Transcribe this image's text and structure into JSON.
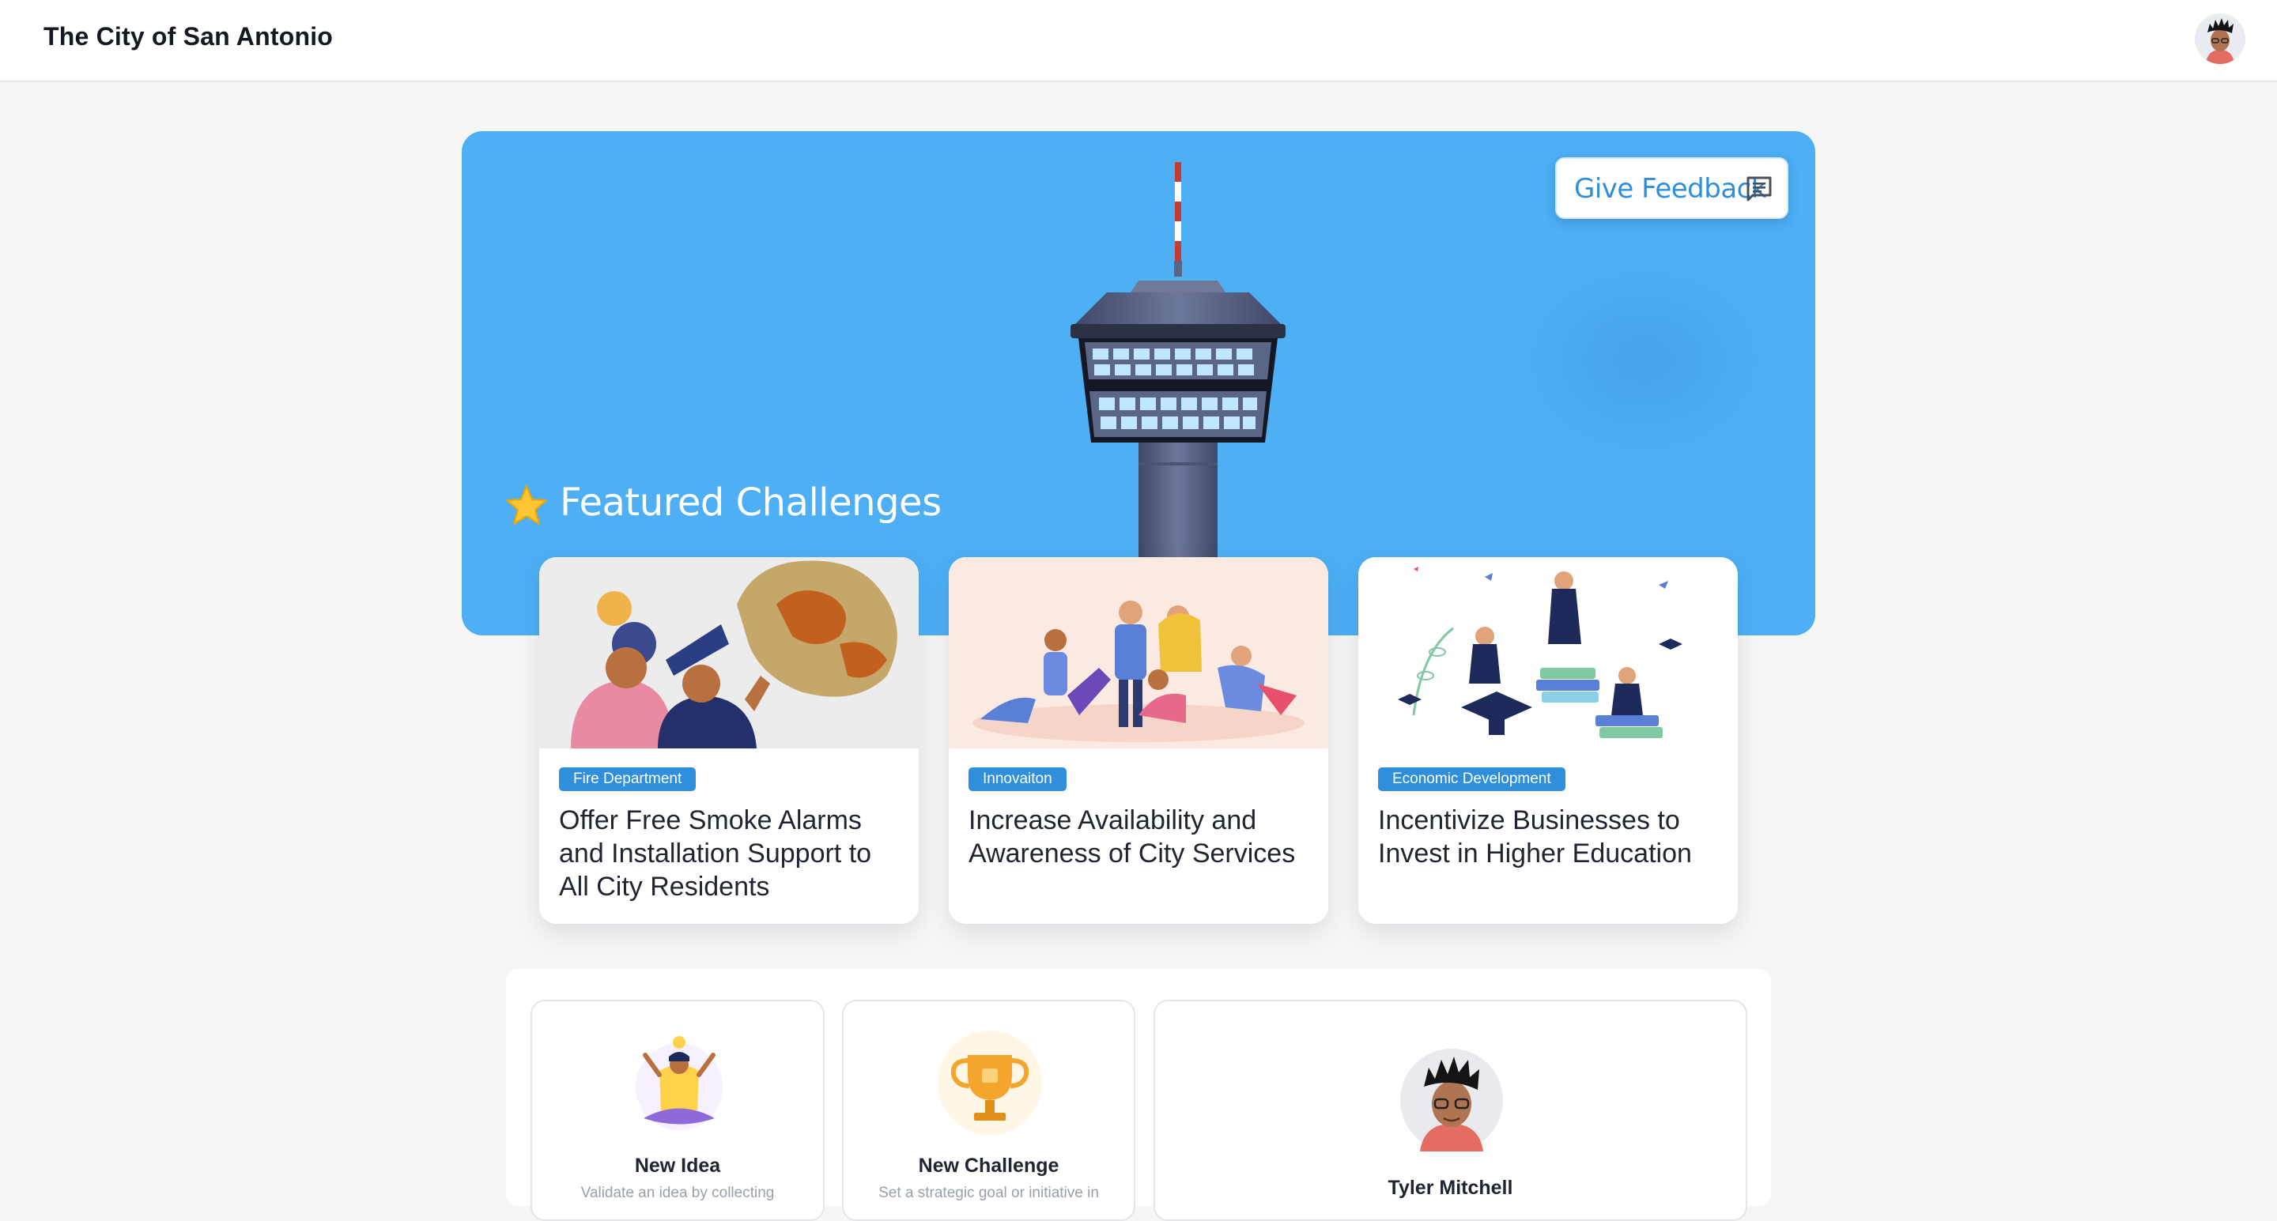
{
  "header": {
    "app_title": "The City of San Antonio"
  },
  "hero": {
    "feedback_label": "Give Feedback",
    "featured_title": "Featured Challenges",
    "background_color": "#4eaff5"
  },
  "challenges": [
    {
      "tag": "Fire Department",
      "title": "Offer Free Smoke Alarms and Installation Support to All City Residents"
    },
    {
      "tag": "Innovaiton",
      "title": "Increase Availability and Awareness of City Services"
    },
    {
      "tag": "Economic Development",
      "title": "Incentivize Businesses to Invest in Higher Education"
    }
  ],
  "actions": {
    "new_idea": {
      "title": "New Idea",
      "description": "Validate an idea by collecting"
    },
    "new_challenge": {
      "title": "New Challenge",
      "description": "Set a strategic goal or initiative in"
    }
  },
  "profile": {
    "name": "Tyler Mitchell"
  },
  "colors": {
    "accent": "#2f8fdc",
    "tower_body": "#5b6585",
    "tower_windows": "#bfe6fb"
  }
}
